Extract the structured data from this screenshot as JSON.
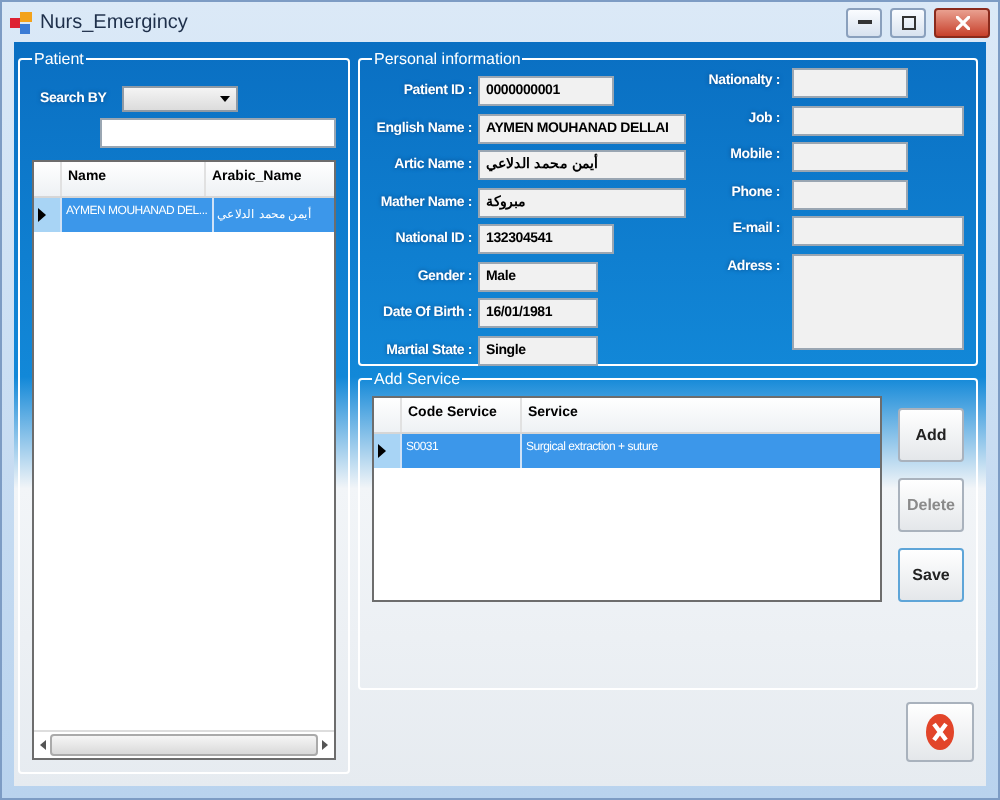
{
  "window": {
    "title": "Nurs_Emergincy"
  },
  "patient": {
    "title": "Patient",
    "search_label": "Search BY",
    "table": {
      "columns": [
        "Name",
        "Arabic_Name"
      ],
      "rows": [
        {
          "cells": [
            "AYMEN MOUHANAD DEL...",
            "أيمن محمد الدلاعي"
          ],
          "selected": true
        }
      ]
    }
  },
  "personal": {
    "title": "Personal information",
    "left": [
      {
        "label": "Patient ID :",
        "value": "0000000001"
      },
      {
        "label": "English Name :",
        "value": "AYMEN MOUHANAD DELLAI"
      },
      {
        "label": "Artic Name :",
        "value": "أيمن محمد الدلاعي"
      },
      {
        "label": "Mather Name :",
        "value": "مبروكة"
      },
      {
        "label": "National ID :",
        "value": "132304541"
      },
      {
        "label": "Gender :",
        "value": "Male"
      },
      {
        "label": "Date Of Birth :",
        "value": "16/01/1981"
      },
      {
        "label": "Martial State :",
        "value": "Single"
      }
    ],
    "right": [
      {
        "label": "Nationalty :"
      },
      {
        "label": "Job :"
      },
      {
        "label": "Mobile :"
      },
      {
        "label": "Phone :"
      },
      {
        "label": "E-mail :"
      },
      {
        "label": "Adress :"
      }
    ]
  },
  "service": {
    "title": "Add Service",
    "table": {
      "columns": [
        "Code Service",
        "Service"
      ],
      "rows": [
        {
          "cells": [
            "S0031",
            "Surgical extraction + suture"
          ],
          "selected": true
        }
      ]
    },
    "buttons": [
      {
        "label": "Add",
        "disabled": false
      },
      {
        "label": "Delete",
        "disabled": true
      },
      {
        "label": "Save",
        "disabled": false
      }
    ]
  }
}
